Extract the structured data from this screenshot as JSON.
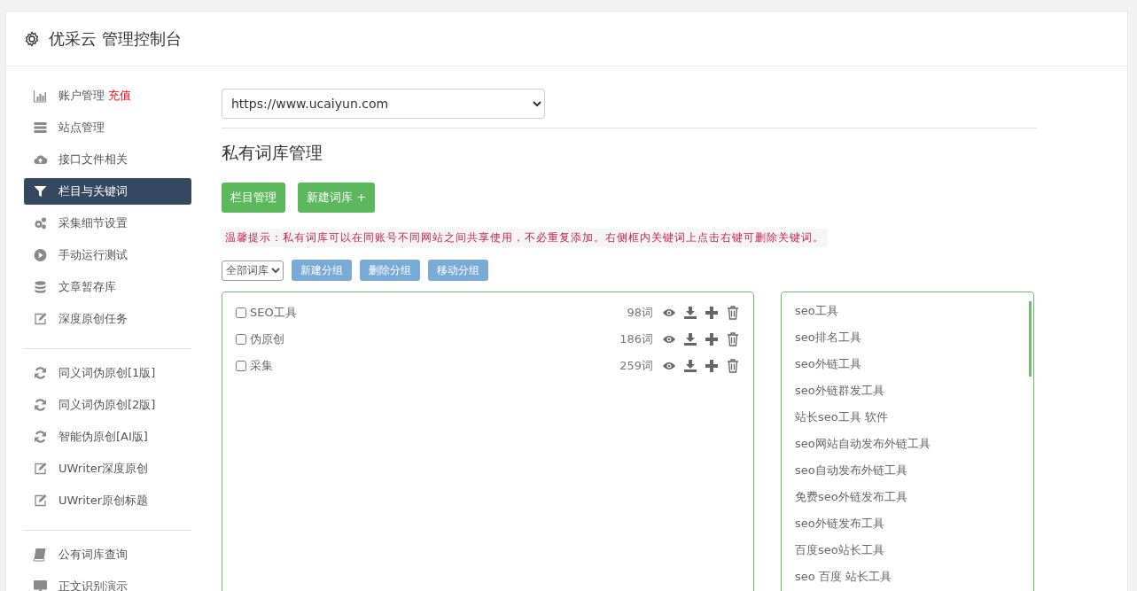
{
  "header": {
    "title": "优采云 管理控制台"
  },
  "sidebar": {
    "groups": [
      {
        "items": [
          {
            "label": "账户管理",
            "badge": "充值",
            "kind": "chart",
            "selected": false
          },
          {
            "label": "站点管理",
            "kind": "server",
            "selected": false
          },
          {
            "label": "接口文件相关",
            "kind": "cloud",
            "selected": false
          },
          {
            "label": "栏目与关键词",
            "kind": "filter",
            "selected": true
          },
          {
            "label": "采集细节设置",
            "kind": "gears",
            "selected": false
          },
          {
            "label": "手动运行测试",
            "kind": "play",
            "selected": false
          },
          {
            "label": "文章暂存库",
            "kind": "database",
            "selected": false
          },
          {
            "label": "深度原创任务",
            "kind": "edit",
            "selected": false
          }
        ]
      },
      {
        "items": [
          {
            "label": "同义词伪原创[1版]",
            "kind": "refresh",
            "selected": false
          },
          {
            "label": "同义词伪原创[2版]",
            "kind": "refresh",
            "selected": false
          },
          {
            "label": "智能伪原创[AI版]",
            "kind": "refresh",
            "selected": false
          },
          {
            "label": "UWriter深度原创",
            "kind": "edit",
            "selected": false
          },
          {
            "label": "UWriter原创标题",
            "kind": "edit",
            "selected": false
          }
        ]
      },
      {
        "items": [
          {
            "label": "公有词库查询",
            "kind": "book",
            "selected": false
          },
          {
            "label": "正文识别演示",
            "kind": "monitor",
            "selected": false
          }
        ]
      }
    ]
  },
  "site_select": {
    "value": "https://www.ucaiyun.com"
  },
  "section_title": "私有词库管理",
  "actions": [
    "栏目管理",
    "新建词库 +"
  ],
  "tip": "温馨提示：私有词库可以在同账号不同网站之间共享使用，不必重复添加。右侧框内关键词上点击右键可删除关键词。",
  "group_select": {
    "value": "全部词库"
  },
  "group_buttons": [
    "新建分组",
    "删除分组",
    "移动分组"
  ],
  "libraries": [
    {
      "name": "SEO工具",
      "count": "98词",
      "checked": false
    },
    {
      "name": "伪原创",
      "count": "186词",
      "checked": false
    },
    {
      "name": "采集",
      "count": "259词",
      "checked": false
    }
  ],
  "keywords": [
    "seo工具",
    "seo排名工具",
    "seo外链工具",
    "seo外链群发工具",
    "站长seo工具 软件",
    "seo网站自动发布外链工具",
    "seo自动发布外链工具",
    "免费seo外链发布工具",
    "seo外链发布工具",
    "百度seo站长工具",
    "seo 百度 站长工具"
  ]
}
